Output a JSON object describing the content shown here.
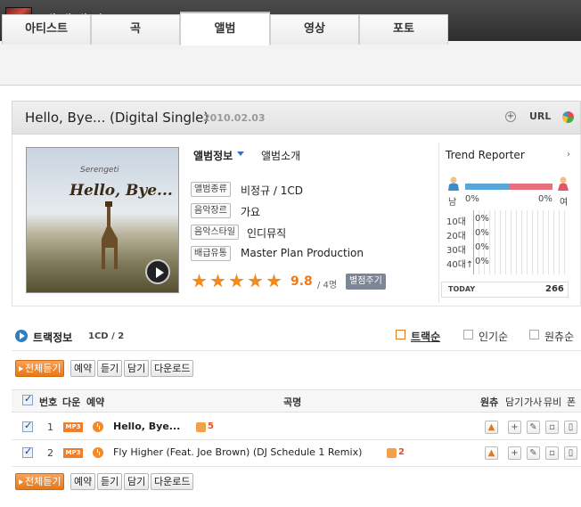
{
  "header": {
    "title": "세렝게티(Serengeti)"
  },
  "tabs": [
    {
      "label": "아티스트"
    },
    {
      "label": "곡"
    },
    {
      "label": "앨범",
      "active": true
    },
    {
      "label": "영상"
    },
    {
      "label": "포토"
    }
  ],
  "album": {
    "title": "Hello, Bye... (Digital Single)",
    "date": "2010.02.03",
    "url_label": "URL",
    "cover_brand": "Serengeti",
    "cover_title": "Hello, Bye...",
    "info_tab": "앨범정보",
    "intro_tab": "앨범소개",
    "fields": [
      {
        "label": "앨범종류",
        "value": "비정규 / 1CD"
      },
      {
        "label": "음악장르",
        "value": "가요"
      },
      {
        "label": "음악스타일",
        "value": "인디뮤직"
      },
      {
        "label": "배급유통",
        "value": "Master Plan Production"
      }
    ],
    "rating": {
      "stars": 5,
      "score": "9.8",
      "votes": "/ 4명",
      "rate_button": "별점주기"
    }
  },
  "trend": {
    "title": "Trend Reporter",
    "male_label": "남",
    "female_label": "여",
    "male_pct": "0%",
    "female_pct": "0%",
    "ages": [
      {
        "label": "10대",
        "pct": "0%"
      },
      {
        "label": "20대",
        "pct": "0%"
      },
      {
        "label": "30대",
        "pct": "0%"
      },
      {
        "label": "40대↑",
        "pct": "0%"
      }
    ],
    "today_label": "TODAY",
    "today_value": "266"
  },
  "tracks": {
    "title": "트랙정보",
    "count": "1CD / 2",
    "sort": [
      "트랙순",
      "인기순",
      "원츄순"
    ],
    "buttons": {
      "play_all": "전체듣기",
      "reserve": "예약",
      "listen": "듣기",
      "save": "담기",
      "download": "다운로드"
    },
    "headers": {
      "no": "번호",
      "next": "다운",
      "reserve": "예약",
      "song": "곡명",
      "wantchu": "원츄",
      "save": "담기",
      "lyrics": "가사",
      "mv": "뮤비",
      "phone": "폰"
    },
    "rows": [
      {
        "no": "1",
        "badge": "MP3",
        "title": "Hello, Bye...",
        "likes": "5",
        "bold": true
      },
      {
        "no": "2",
        "badge": "MP3",
        "title": "Fly Higher (Feat. Joe Brown) (DJ Schedule 1 Remix)",
        "likes": "2",
        "bold": false
      }
    ]
  }
}
